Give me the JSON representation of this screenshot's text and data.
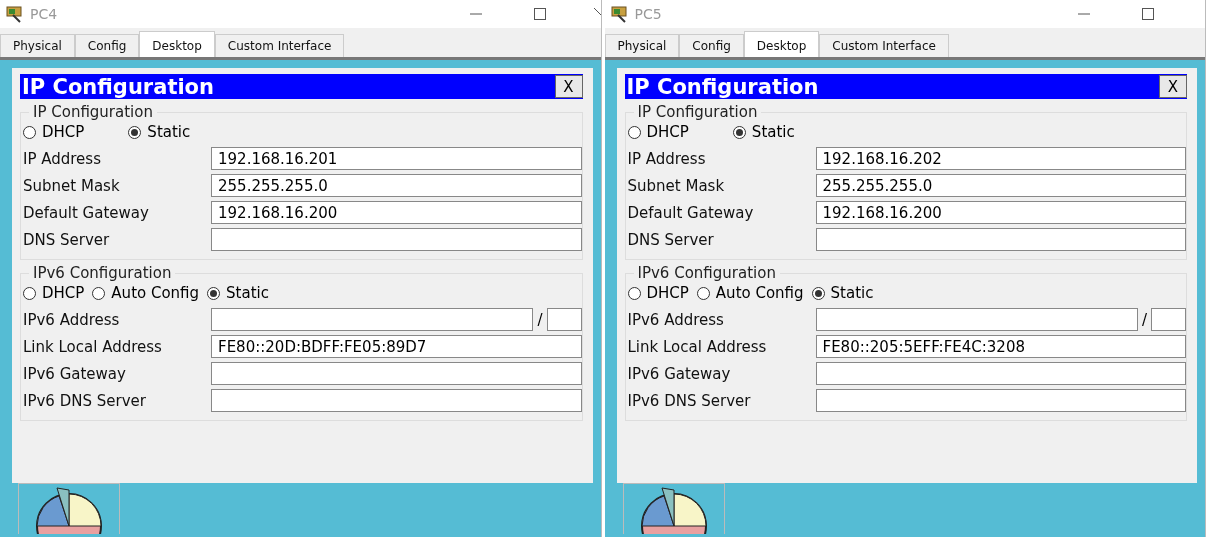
{
  "windows": [
    {
      "title": "PC4",
      "tabs": [
        {
          "label": "Physical",
          "selected": false
        },
        {
          "label": "Config",
          "selected": false
        },
        {
          "label": "Desktop",
          "selected": true
        },
        {
          "label": "Custom Interface",
          "selected": false
        }
      ],
      "dialog": {
        "title": "IP Configuration",
        "close": "X",
        "ipv4": {
          "legend": "IP Configuration",
          "modes": [
            {
              "label": "DHCP",
              "selected": false
            },
            {
              "label": "Static",
              "selected": true
            }
          ],
          "fields": [
            {
              "label": "IP Address",
              "value": "192.168.16.201"
            },
            {
              "label": "Subnet Mask",
              "value": "255.255.255.0"
            },
            {
              "label": "Default Gateway",
              "value": "192.168.16.200"
            },
            {
              "label": "DNS Server"
            }
          ]
        },
        "ipv6": {
          "legend": "IPv6 Configuration",
          "modes": [
            {
              "label": "DHCP",
              "selected": false
            },
            {
              "label": "Auto Config",
              "selected": false
            },
            {
              "label": "Static",
              "selected": true
            }
          ],
          "fields": [
            {
              "label": "IPv6 Address",
              "kind": "prefix",
              "separator": "/"
            },
            {
              "label": "Link Local Address",
              "value": "FE80::20D:BDFF:FE05:89D7"
            },
            {
              "label": "IPv6 Gateway"
            },
            {
              "label": "IPv6 DNS Server"
            }
          ]
        }
      }
    },
    {
      "title": "PC5",
      "tabs": [
        {
          "label": "Physical",
          "selected": false
        },
        {
          "label": "Config",
          "selected": false
        },
        {
          "label": "Desktop",
          "selected": true
        },
        {
          "label": "Custom Interface",
          "selected": false
        }
      ],
      "dialog": {
        "title": "IP Configuration",
        "close": "X",
        "ipv4": {
          "legend": "IP Configuration",
          "modes": [
            {
              "label": "DHCP",
              "selected": false
            },
            {
              "label": "Static",
              "selected": true
            }
          ],
          "fields": [
            {
              "label": "IP Address",
              "value": "192.168.16.202"
            },
            {
              "label": "Subnet Mask",
              "value": "255.255.255.0"
            },
            {
              "label": "Default Gateway",
              "value": "192.168.16.200"
            },
            {
              "label": "DNS Server"
            }
          ]
        },
        "ipv6": {
          "legend": "IPv6 Configuration",
          "modes": [
            {
              "label": "DHCP",
              "selected": false
            },
            {
              "label": "Auto Config",
              "selected": false
            },
            {
              "label": "Static",
              "selected": true
            }
          ],
          "fields": [
            {
              "label": "IPv6 Address",
              "kind": "prefix",
              "separator": "/"
            },
            {
              "label": "Link Local Address",
              "value": "FE80::205:5EFF:FE4C:3208"
            },
            {
              "label": "IPv6 Gateway"
            },
            {
              "label": "IPv6 DNS Server"
            }
          ]
        }
      }
    }
  ]
}
